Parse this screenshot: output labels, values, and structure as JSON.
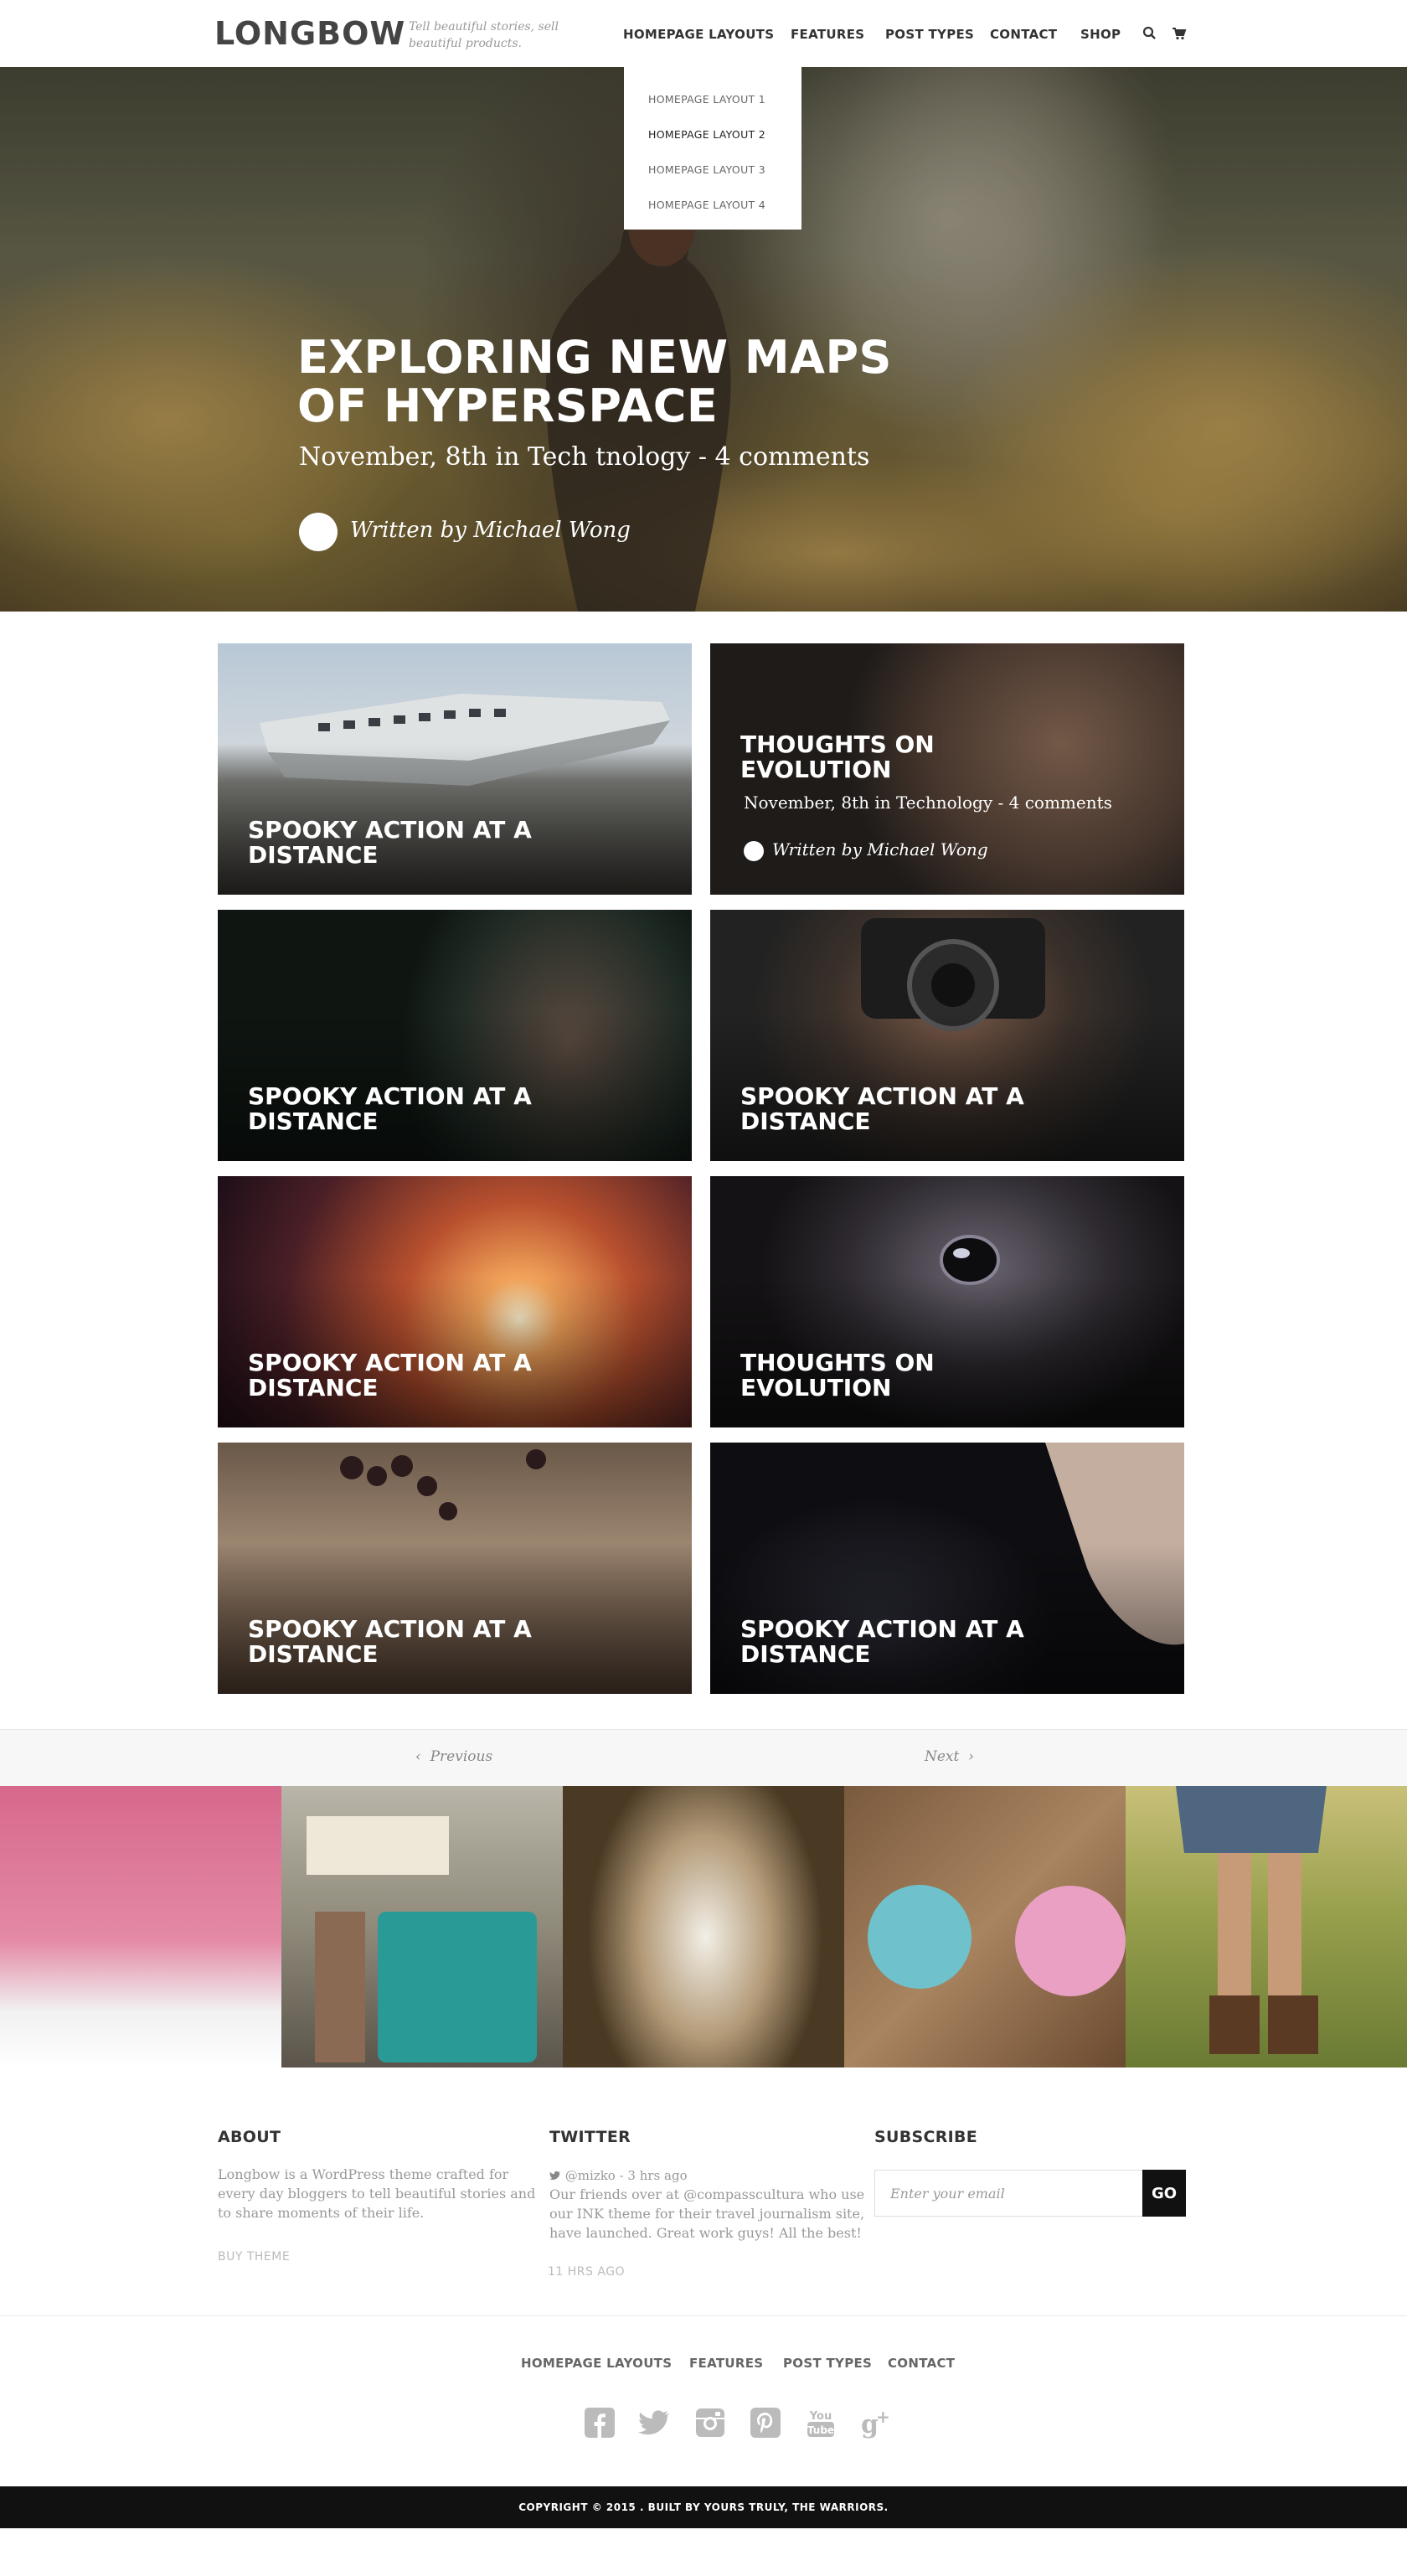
{
  "header": {
    "logo": "LONGBOW",
    "tagline": "Tell beautiful stories, sell beautiful products.",
    "nav": [
      "HOMEPAGE LAYOUTS",
      "FEATURES",
      "POST TYPES",
      "CONTACT",
      "SHOP"
    ],
    "icons": [
      "search-icon",
      "cart-icon"
    ]
  },
  "dropdown": {
    "items": [
      "HOMEPAGE LAYOUT 1",
      "HOMEPAGE LAYOUT 2",
      "HOMEPAGE LAYOUT 3",
      "HOMEPAGE LAYOUT 4"
    ],
    "active_index": 1
  },
  "hero": {
    "title": "EXPLORING NEW MAPS OF HYPERSPACE",
    "meta": "November, 8th in Tech  tnology - 4 comments",
    "author": "Written by Michael Wong"
  },
  "cards": [
    {
      "title": "SPOOKY ACTION AT A DISTANCE"
    },
    {
      "title": "THOUGHTS ON EVOLUTION",
      "meta": "November, 8th in Technology - 4 comments",
      "author": "Written by Michael Wong"
    },
    {
      "title": "SPOOKY ACTION AT A DISTANCE"
    },
    {
      "title": "SPOOKY ACTION AT A DISTANCE"
    },
    {
      "title": "SPOOKY ACTION AT A DISTANCE"
    },
    {
      "title": "THOUGHTS ON EVOLUTION"
    },
    {
      "title": "SPOOKY ACTION AT A DISTANCE"
    },
    {
      "title": "SPOOKY ACTION AT A DISTANCE"
    }
  ],
  "pager": {
    "previous": "Previous",
    "next": "Next"
  },
  "footer": {
    "about": {
      "title": "ABOUT",
      "text": "Longbow is a WordPress theme crafted for every day bloggers to tell beautiful stories and to share moments of their life.",
      "link": "BUY THEME"
    },
    "twitter": {
      "title": "TWITTER",
      "handle": "@mizko - 3 hrs ago",
      "tweet": "Our friends over at @compasscultura who use our INK theme for their travel journalism site, have launched. Great work guys! All the best!",
      "time": "11 HRS AGO"
    },
    "subscribe": {
      "title": "SUBSCRIBE",
      "placeholder": "Enter your email",
      "button": "GO"
    },
    "nav": [
      "HOMEPAGE LAYOUTS",
      "FEATURES",
      "POST TYPES",
      "CONTACT"
    ],
    "social": [
      "facebook-icon",
      "twitter-icon",
      "instagram-icon",
      "pinterest-icon",
      "youtube-icon",
      "google-plus-icon"
    ],
    "copyright": "COPYRIGHT © 2015 . BUILT BY YOURS TRULY, THE WARRIORS."
  }
}
